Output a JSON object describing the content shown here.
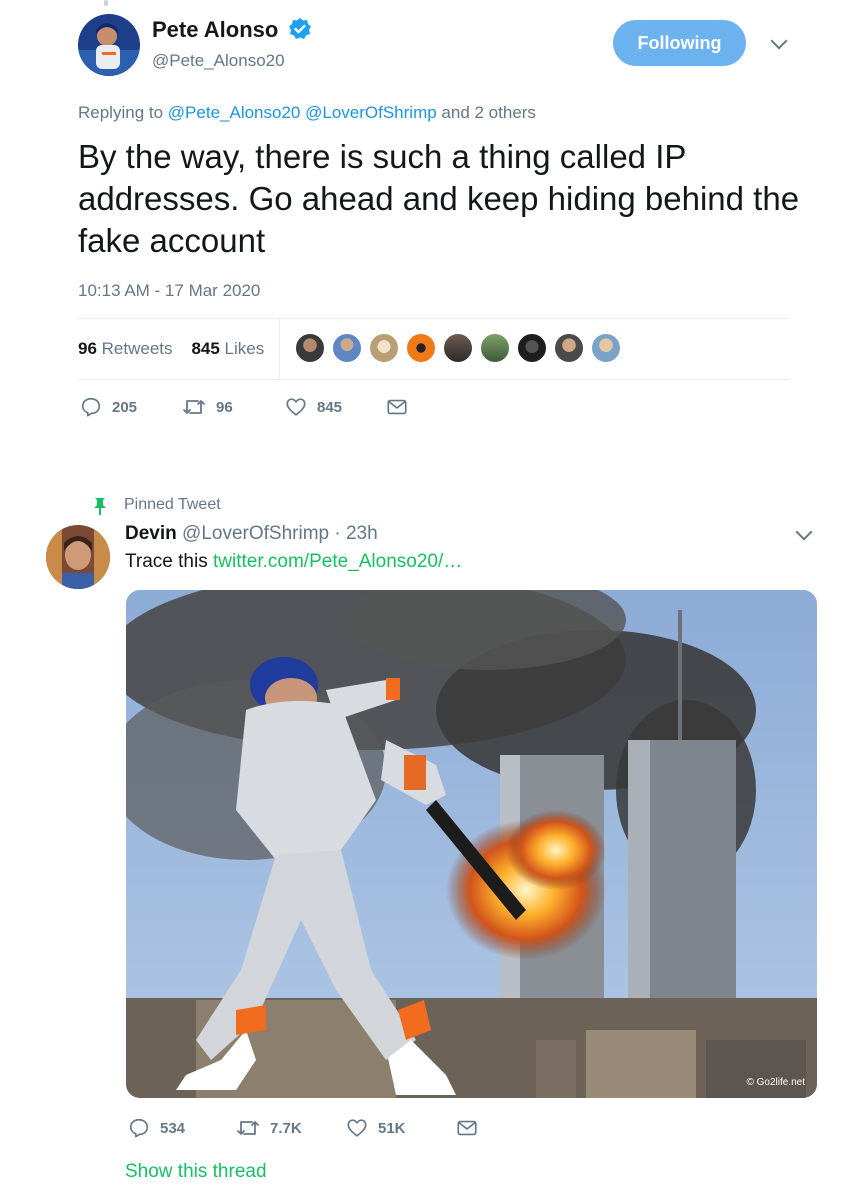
{
  "main_tweet": {
    "author": {
      "name": "Pete Alonso",
      "handle": "@Pete_Alonso20",
      "verified": true
    },
    "follow_button": "Following",
    "reply_prefix": "Replying to",
    "reply_mention_1": "@Pete_Alonso20",
    "reply_mention_2": "@LoverOfShrimp",
    "reply_suffix": "and 2 others",
    "text": "By the way, there is such a thing called IP addresses. Go ahead and keep hiding behind the fake account",
    "timestamp": "10:13 AM - 17 Mar 2020",
    "retweets_count": "96",
    "retweets_label": "Retweets",
    "likes_count": "845",
    "likes_label": "Likes",
    "actions": {
      "replies": "205",
      "retweets": "96",
      "likes": "845"
    }
  },
  "pinned_tweet": {
    "pinned_label": "Pinned Tweet",
    "author": {
      "name": "Devin",
      "handle": "@LoverOfShrimp",
      "time": "· 23h"
    },
    "text_prefix": "Trace this",
    "link": "twitter.com/Pete_Alonso20/…",
    "photo_credit": "© Go2life.net",
    "actions": {
      "replies": "534",
      "retweets": "7.7K",
      "likes": "51K"
    },
    "show_thread": "Show this thread"
  },
  "colors": {
    "accent": "#1b95e0",
    "follow_button": "#6cb2ef",
    "verified": "#1da1f2",
    "pinned_green": "#17bf63",
    "secondary_text": "#657786"
  }
}
